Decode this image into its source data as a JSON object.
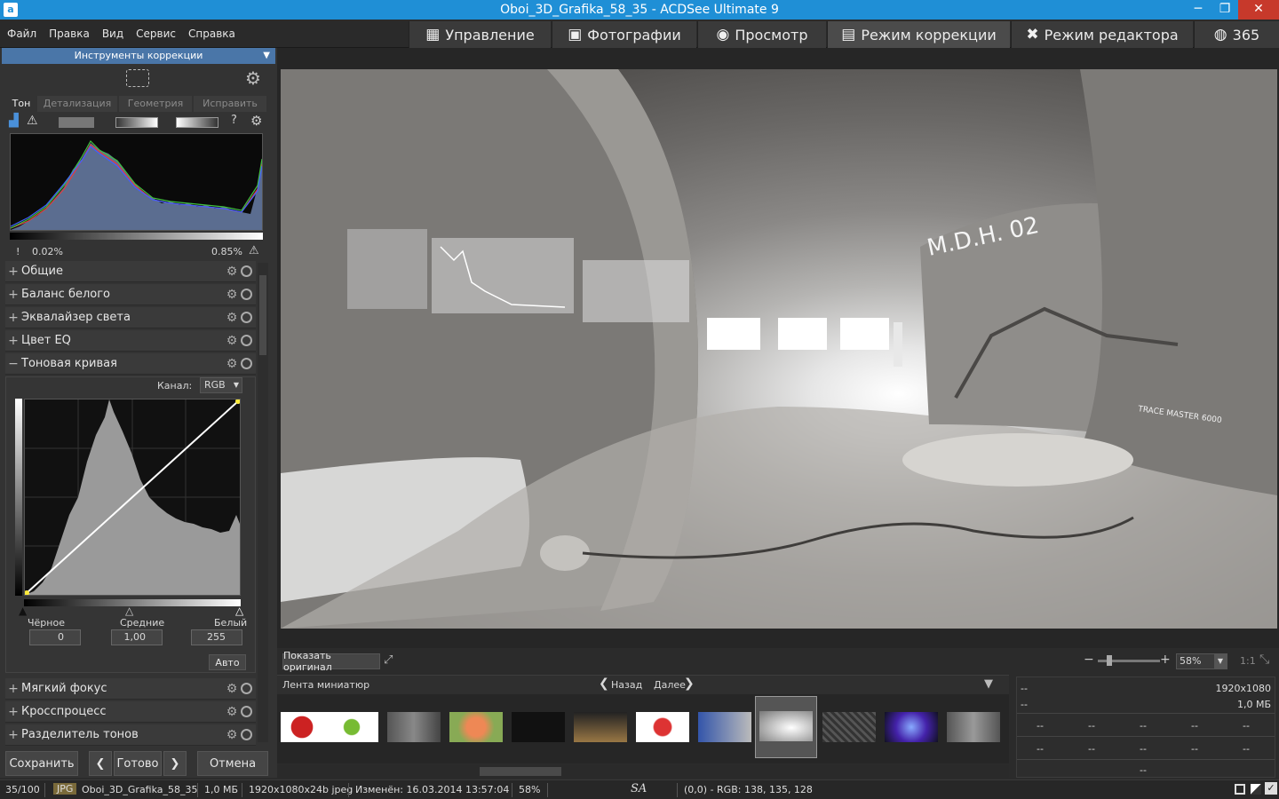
{
  "window": {
    "title": "Oboi_3D_Grafika_58_35 - ACDSee Ultimate 9",
    "minimize": "─",
    "maximize": "❐",
    "close": "✕"
  },
  "menu": [
    "Файл",
    "Правка",
    "Вид",
    "Сервис",
    "Справка"
  ],
  "modes": [
    {
      "label": "Управление",
      "icon": "grid-icon"
    },
    {
      "label": "Фотографии",
      "icon": "photos-icon"
    },
    {
      "label": "Просмотр",
      "icon": "eye-icon"
    },
    {
      "label": "Режим коррекции",
      "icon": "develop-icon"
    },
    {
      "label": "Режим редактора",
      "icon": "tools-icon"
    },
    {
      "label": "365",
      "icon": "365-icon"
    }
  ],
  "panel": {
    "title": "Инструменты коррекции",
    "tabs": [
      "Тон",
      "Детализация",
      "Геометрия",
      "Исправить"
    ],
    "clip_low": "0.02%",
    "clip_high": "0.85%",
    "sections": [
      "Общие",
      "Баланс белого",
      "Эквалайзер света",
      "Цвет EQ"
    ],
    "curve": {
      "label": "Тоновая кривая",
      "channel_label": "Канал:",
      "channel_value": "RGB",
      "black_label": "Чёрное",
      "mid_label": "Средние",
      "white_label": "Белый",
      "black_value": "0",
      "mid_value": "1,00",
      "white_value": "255",
      "auto": "Авто"
    },
    "sections_after": [
      "Мягкий фокус",
      "Кросспроцесс",
      "Разделитель тонов"
    ],
    "save": "Сохранить",
    "done": "Готово",
    "cancel": "Отмена"
  },
  "viewer": {
    "show_original": "Показать оригинал",
    "zoom": "58%",
    "ratio": "1:1"
  },
  "filmstrip": {
    "label": "Лента миниатюр",
    "back": "Назад",
    "next": "Далее"
  },
  "info": {
    "resolution": "1920x1080",
    "size": "1,0 МБ",
    "dash": "--"
  },
  "status": {
    "index": "35/100",
    "type": "JPG",
    "name": "Oboi_3D_Grafika_58_35",
    "size": "1,0 МБ",
    "dims": "1920x1080x24b jpeg",
    "modified": "Изменён: 16.03.2014 13:57:04",
    "zoom": "58%",
    "sa": "SA",
    "rgb": "(0,0) - RGB: 138, 135, 128"
  },
  "image_text": {
    "mdh": "M.D.H. 02",
    "trace": "TRACE MASTER 6000"
  }
}
